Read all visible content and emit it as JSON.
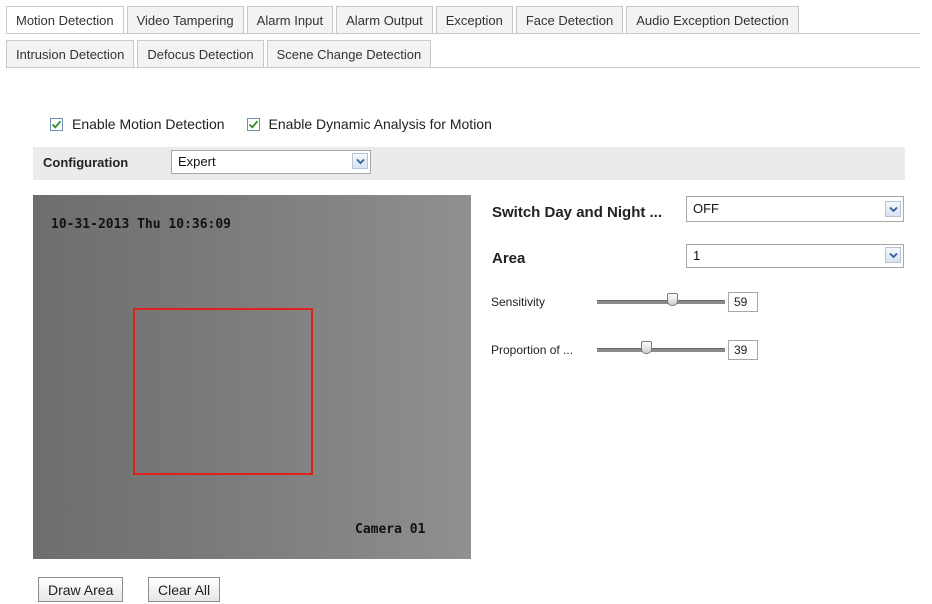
{
  "tabs_row1": [
    "Motion Detection",
    "Video Tampering",
    "Alarm Input",
    "Alarm Output",
    "Exception",
    "Face Detection",
    "Audio Exception Detection"
  ],
  "tabs_row2": [
    "Intrusion Detection",
    "Defocus Detection",
    "Scene Change Detection"
  ],
  "active_tab": "Motion Detection",
  "checkboxes": {
    "enable_motion": {
      "label": "Enable Motion Detection",
      "checked": true
    },
    "enable_dynamic": {
      "label": "Enable Dynamic Analysis for Motion",
      "checked": true
    }
  },
  "configuration": {
    "label": "Configuration",
    "value": "Expert"
  },
  "video": {
    "timestamp": "10-31-2013 Thu 10:36:09",
    "camera_name": "Camera 01"
  },
  "settings": {
    "switch_day_night": {
      "label": "Switch Day and Night ...",
      "value": "OFF"
    },
    "area": {
      "label": "Area",
      "value": "1"
    },
    "sensitivity": {
      "label": "Sensitivity",
      "value": "59"
    },
    "proportion": {
      "label": "Proportion of ...",
      "value": "39"
    }
  },
  "buttons": {
    "draw_area": "Draw Area",
    "clear_all": "Clear All"
  },
  "colors": {
    "area_box": "#e0201c",
    "config_bar": "#ebebeb",
    "checkbox_check": "#2e8b2e"
  }
}
